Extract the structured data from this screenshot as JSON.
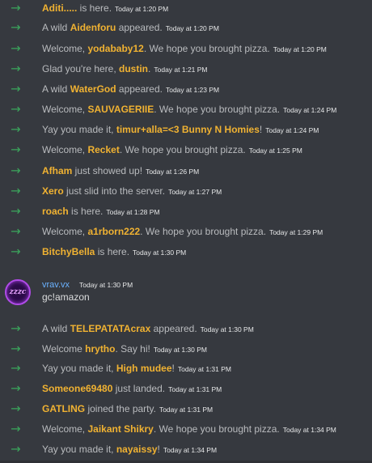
{
  "messages": [
    {
      "prefix": "",
      "name": "Aditi.....",
      "suffix": " is here.",
      "ts": "Today at 1:20 PM"
    },
    {
      "prefix": "A wild ",
      "name": "Aidenforu",
      "suffix": " appeared.",
      "ts": "Today at 1:20 PM"
    },
    {
      "prefix": "Welcome, ",
      "name": "yodababy12",
      "suffix": ". We hope you brought pizza.",
      "ts": "Today at 1:20 PM"
    },
    {
      "prefix": "Glad you're here, ",
      "name": "dustin",
      "suffix": ".",
      "ts": "Today at 1:21 PM"
    },
    {
      "prefix": "A wild ",
      "name": "WaterGod",
      "suffix": " appeared.",
      "ts": "Today at 1:23 PM"
    },
    {
      "prefix": "Welcome, ",
      "name": "SAUVAGERIIE",
      "suffix": ". We hope you brought pizza.",
      "ts": "Today at 1:24 PM"
    },
    {
      "prefix": "Yay you made it, ",
      "name": "timur+alla=<3 Bunny N Homies",
      "suffix": "!",
      "ts": "Today at 1:24 PM"
    },
    {
      "prefix": "Welcome, ",
      "name": "Recket",
      "suffix": ". We hope you brought pizza.",
      "ts": "Today at 1:25 PM"
    },
    {
      "prefix": "",
      "name": "Afham",
      "suffix": " just showed up!",
      "ts": "Today at 1:26 PM"
    },
    {
      "prefix": "",
      "name": "Xero",
      "suffix": " just slid into the server.",
      "ts": "Today at 1:27 PM"
    },
    {
      "prefix": "",
      "name": "roach",
      "suffix": " is here.",
      "ts": "Today at 1:28 PM"
    },
    {
      "prefix": "Welcome, ",
      "name": "a1rborn222",
      "suffix": ". We hope you brought pizza.",
      "ts": "Today at 1:29 PM"
    },
    {
      "prefix": "",
      "name": "BitchyBella",
      "suffix": " is here.",
      "ts": "Today at 1:30 PM"
    },
    {
      "prefix": "A wild ",
      "name": "TELEPATATAcrax",
      "suffix": " appeared.",
      "ts": "Today at 1:30 PM"
    },
    {
      "prefix": "Welcome ",
      "name": "hrytho",
      "suffix": ". Say hi!",
      "ts": "Today at 1:30 PM"
    },
    {
      "prefix": "Yay you made it, ",
      "name": "High mudee",
      "suffix": "!",
      "ts": "Today at 1:31 PM"
    },
    {
      "prefix": "",
      "name": "Someone69480",
      "suffix": " just landed.",
      "ts": "Today at 1:31 PM"
    },
    {
      "prefix": "",
      "name": "GATLING",
      "suffix": " joined the party.",
      "ts": "Today at 1:31 PM"
    },
    {
      "prefix": "Welcome, ",
      "name": "Jaikant Shikry",
      "suffix": ". We hope you brought pizza.",
      "ts": "Today at 1:34 PM"
    },
    {
      "prefix": "Yay you made it, ",
      "name": "nayaissy",
      "suffix": "!",
      "ts": "Today at 1:34 PM"
    }
  ],
  "user_message": {
    "avatar_text": "zzzc",
    "username": "vrav.vx",
    "ts": "Today at 1:30 PM",
    "body": "gc!amazon"
  },
  "icons": {
    "join_arrow": "arrow-right-icon"
  },
  "colors": {
    "background": "#36393f",
    "name": "#f0b232",
    "arrow": "#3ba55c",
    "username": "#6bb2ff"
  }
}
